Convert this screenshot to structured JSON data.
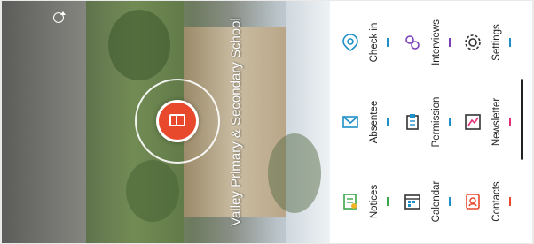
{
  "school": {
    "name": "Valley Primary & Secondary School"
  },
  "header": {
    "sync_icon": "sync-icon",
    "logo_icon": "book-icon"
  },
  "menu": {
    "items": [
      {
        "label": "Check in",
        "icon": "location-pin-icon",
        "accent": "#1e8fc7"
      },
      {
        "label": "Absentee",
        "icon": "envelope-icon",
        "accent": "#1e8fc7"
      },
      {
        "label": "Notices",
        "icon": "notice-board-icon",
        "accent": "#3aa64a"
      },
      {
        "label": "Interviews",
        "icon": "people-icon",
        "accent": "#7a3fb8"
      },
      {
        "label": "Permission",
        "icon": "clipboard-icon",
        "accent": "#1e8fc7"
      },
      {
        "label": "Calendar",
        "icon": "calendar-icon",
        "accent": "#1e8fc7"
      },
      {
        "label": "Settings",
        "icon": "gear-icon",
        "accent": "#1e8fc7"
      },
      {
        "label": "Newsletter",
        "icon": "newsletter-icon",
        "accent": "#e0317a"
      },
      {
        "label": "Contacts",
        "icon": "contacts-icon",
        "accent": "#e8482b"
      }
    ]
  }
}
